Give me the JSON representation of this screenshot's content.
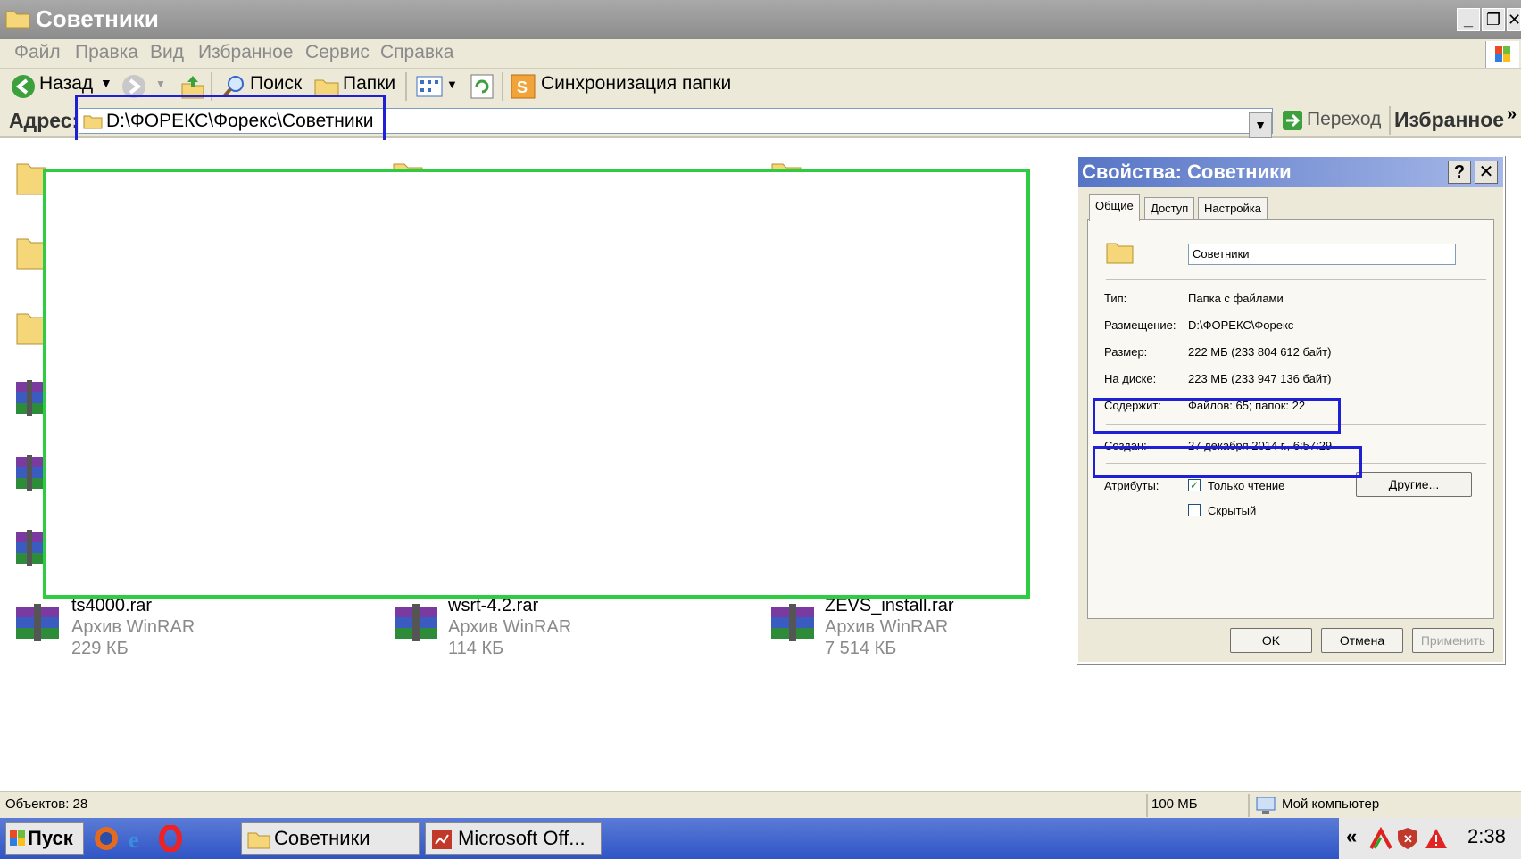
{
  "window": {
    "title": "Советники"
  },
  "menu": [
    "Файл",
    "Правка",
    "Вид",
    "Избранное",
    "Сервис",
    "Справка"
  ],
  "toolbar": {
    "back": "Назад",
    "search": "Поиск",
    "folders": "Папки",
    "sync": "Синхронизация папки"
  },
  "address": {
    "label": "Адрес:",
    "value": "D:\\ФОРЕКС\\Форекс\\Советники",
    "go": "Переход",
    "favorites": "Избранное"
  },
  "files": [
    {
      "name": "ts4000.rar",
      "type": "Архив WinRAR",
      "size": "229 КБ"
    },
    {
      "name": "wsrt-4.2.rar",
      "type": "Архив WinRAR",
      "size": "114 КБ"
    },
    {
      "name": "ZEVS_install.rar",
      "type": "Архив WinRAR",
      "size": "7 514 КБ"
    }
  ],
  "dialog": {
    "title": "Свойства: Советники",
    "help_btn": "?",
    "close_btn": "✕",
    "tabs": [
      "Общие",
      "Доступ",
      "Настройка"
    ],
    "folder_name": "Советники",
    "type_label": "Тип:",
    "type_value": "Папка с файлами",
    "location_label": "Размещение:",
    "location_value": "D:\\ФОРЕКС\\Форекс",
    "size_label": "Размер:",
    "size_value": "222 МБ (233 804 612 байт)",
    "disk_label": "На диске:",
    "disk_value": "223 МБ (233 947 136 байт)",
    "contains_label": "Содержит:",
    "contains_value": "Файлов: 65; папок: 22",
    "created_label": "Создан:",
    "created_value": "27 декабря 2014 г., 6:57:29",
    "attributes_label": "Атрибуты:",
    "readonly_label": "Только чтение",
    "readonly_checked": true,
    "hidden_label": "Скрытый",
    "hidden_checked": false,
    "other_btn": "Другие...",
    "ok_btn": "OK",
    "cancel_btn": "Отмена",
    "apply_btn": "Применить"
  },
  "status": {
    "objects": "Объектов: 28",
    "size": "100 МБ",
    "computer": "Мой компьютер"
  },
  "taskbar": {
    "start": "Пуск",
    "tasks": [
      "Советники",
      "Microsoft Off..."
    ],
    "clock": "2:38",
    "tray_arrow": "«"
  },
  "colors": {
    "highlight_green": "#2ecc40",
    "highlight_blue": "#1f1fd6",
    "dialog_title": "#5775c6"
  }
}
